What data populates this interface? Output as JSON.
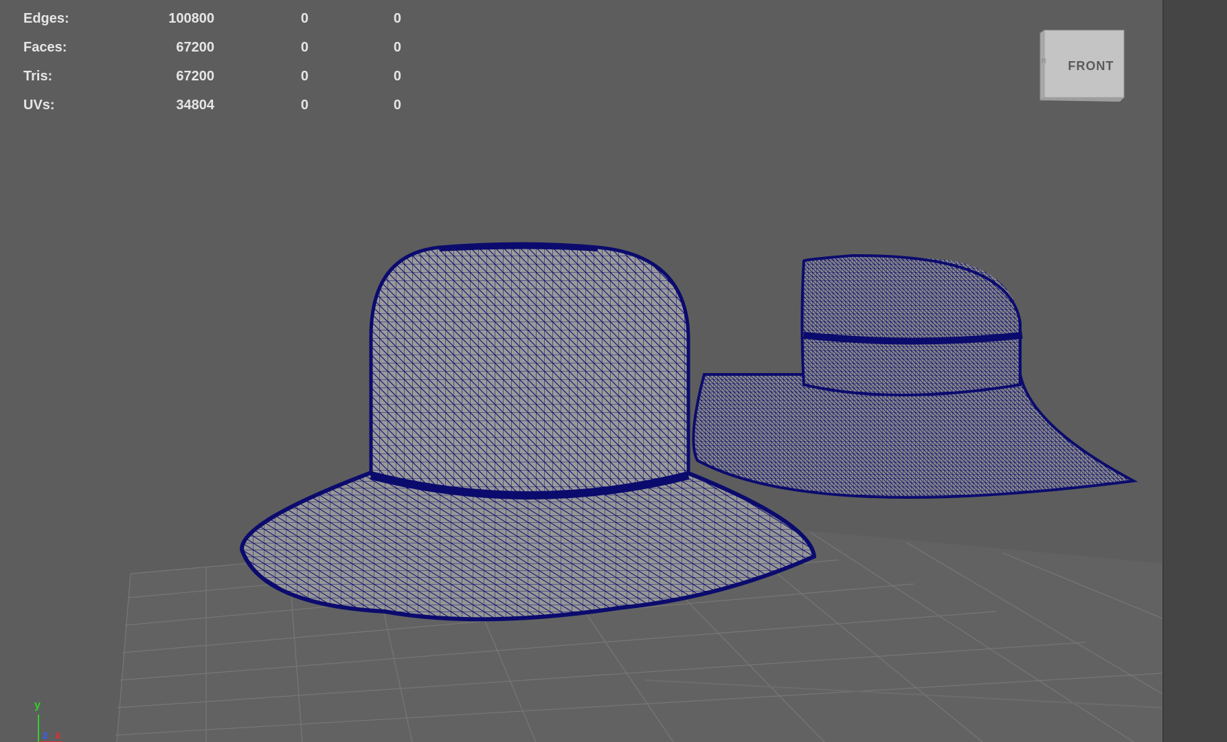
{
  "stats": [
    {
      "label": "Edges:",
      "total": "100800",
      "selected": "0",
      "triangles": "0"
    },
    {
      "label": "Faces:",
      "total": "67200",
      "selected": "0",
      "triangles": "0"
    },
    {
      "label": "Tris:",
      "total": "67200",
      "selected": "0",
      "triangles": "0"
    },
    {
      "label": "UVs:",
      "total": "34804",
      "selected": "0",
      "triangles": "0"
    }
  ],
  "viewcube": {
    "label": "FRONT"
  },
  "axis": {
    "y": "y",
    "z": "z",
    "x": "x"
  },
  "colors": {
    "viewport_bg": "#5d5d5d",
    "wireframe": "#0b0b6e",
    "grid": "#777777",
    "stat_text": "#e6e6e6",
    "axis_x": "#e03030",
    "axis_y": "#30d030",
    "axis_z": "#3060ff"
  },
  "icons": [
    "view-cube-icon",
    "axis-gizmo-icon"
  ]
}
